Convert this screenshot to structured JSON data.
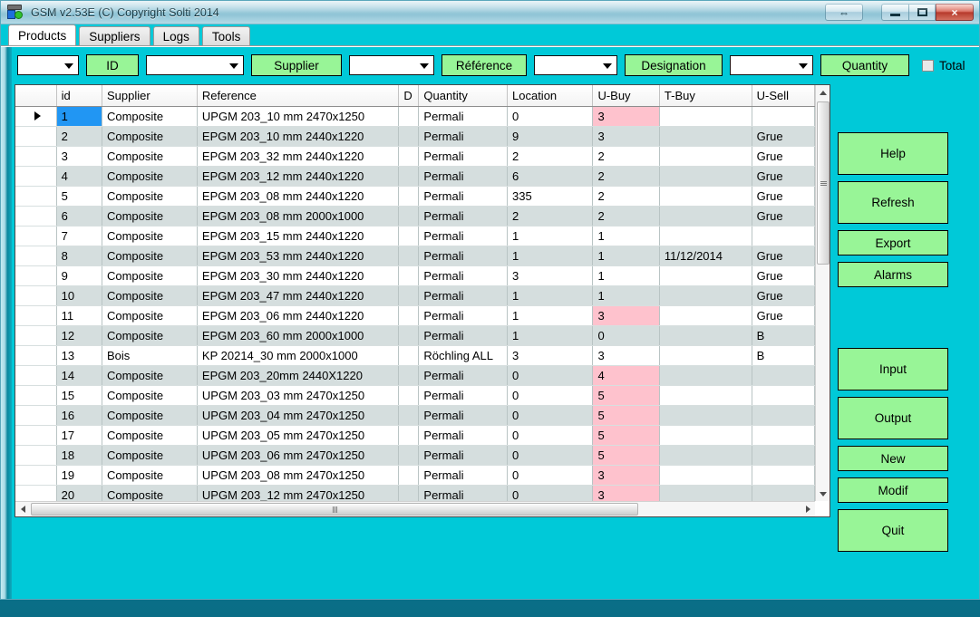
{
  "window": {
    "title": "GSM v2.53E (C) Copyright Solti 2014",
    "icon": "app-book-icon",
    "buttons": {
      "resize": "⇔",
      "minimize": "minimize-icon",
      "maximize": "maximize-icon",
      "close": "×"
    }
  },
  "tabs": [
    {
      "label": "Products",
      "active": true
    },
    {
      "label": "Suppliers",
      "active": false
    },
    {
      "label": "Logs",
      "active": false
    },
    {
      "label": "Tools",
      "active": false
    }
  ],
  "filterbar": {
    "combos": [
      {
        "id": "cb-id",
        "value": ""
      },
      {
        "id": "cb-supplier",
        "value": ""
      },
      {
        "id": "cb-reference",
        "value": ""
      },
      {
        "id": "cb-designation",
        "value": ""
      },
      {
        "id": "cb-quantity",
        "value": ""
      }
    ],
    "buttons": [
      {
        "id": "btn-id",
        "label": "ID"
      },
      {
        "id": "btn-supplier",
        "label": "Supplier"
      },
      {
        "id": "btn-reference",
        "label": "Référence"
      },
      {
        "id": "btn-designation",
        "label": "Designation"
      },
      {
        "id": "btn-quantity",
        "label": "Quantity"
      }
    ],
    "total": {
      "label": "Total",
      "checked": false
    }
  },
  "grid": {
    "columns": [
      {
        "key": "marker",
        "label": ""
      },
      {
        "key": "id",
        "label": "id"
      },
      {
        "key": "sup",
        "label": "Supplier"
      },
      {
        "key": "ref",
        "label": "Reference"
      },
      {
        "key": "desig",
        "label": "D"
      },
      {
        "key": "loc",
        "label": "Quantity"
      },
      {
        "key": "qty",
        "label": "Location"
      },
      {
        "key": "ubuy",
        "label": "U-Buy"
      },
      {
        "key": "tbuy",
        "label": "T-Buy"
      },
      {
        "key": "usell",
        "label": "U-Sell"
      }
    ],
    "rows": [
      {
        "marker": true,
        "id": "1",
        "sup": "Composite",
        "ref": "UPGM 203_10 mm 2470x1250",
        "desig": "",
        "loc": "Permali",
        "qty": "0",
        "ubuy": "3",
        "ubuy_warn": true,
        "tbuy": "",
        "usell": "",
        "selected": true
      },
      {
        "marker": false,
        "id": "2",
        "sup": "Composite",
        "ref": "EPGM 203_10 mm 2440x1220",
        "desig": "",
        "loc": "Permali",
        "qty": "9",
        "ubuy": "3",
        "ubuy_warn": false,
        "tbuy": "",
        "usell": "Grue"
      },
      {
        "marker": false,
        "id": "3",
        "sup": "Composite",
        "ref": "EPGM 203_32 mm 2440x1220",
        "desig": "",
        "loc": "Permali",
        "qty": "2",
        "ubuy": "2",
        "ubuy_warn": false,
        "tbuy": "",
        "usell": "Grue"
      },
      {
        "marker": false,
        "id": "4",
        "sup": "Composite",
        "ref": "EPGM 203_12 mm 2440x1220",
        "desig": "",
        "loc": "Permali",
        "qty": "6",
        "ubuy": "2",
        "ubuy_warn": false,
        "tbuy": "",
        "usell": "Grue"
      },
      {
        "marker": false,
        "id": "5",
        "sup": "Composite",
        "ref": "EPGM 203_08 mm 2440x1220",
        "desig": "",
        "loc": "Permali",
        "qty": "335",
        "ubuy": "2",
        "ubuy_warn": false,
        "tbuy": "",
        "usell": "Grue"
      },
      {
        "marker": false,
        "id": "6",
        "sup": "Composite",
        "ref": "EPGM 203_08 mm 2000x1000",
        "desig": "",
        "loc": "Permali",
        "qty": "2",
        "ubuy": "2",
        "ubuy_warn": false,
        "tbuy": "",
        "usell": "Grue"
      },
      {
        "marker": false,
        "id": "7",
        "sup": "Composite",
        "ref": "EPGM 203_15 mm 2440x1220",
        "desig": "",
        "loc": "Permali",
        "qty": "1",
        "ubuy": "1",
        "ubuy_warn": false,
        "tbuy": "",
        "usell": ""
      },
      {
        "marker": false,
        "id": "8",
        "sup": "Composite",
        "ref": "EPGM 203_53 mm 2440x1220",
        "desig": "",
        "loc": "Permali",
        "qty": "1",
        "ubuy": "1",
        "ubuy_warn": false,
        "tbuy": "11/12/2014",
        "usell": "Grue"
      },
      {
        "marker": false,
        "id": "9",
        "sup": "Composite",
        "ref": "EPGM 203_30 mm 2440x1220",
        "desig": "",
        "loc": "Permali",
        "qty": "3",
        "ubuy": "1",
        "ubuy_warn": false,
        "tbuy": "",
        "usell": "Grue"
      },
      {
        "marker": false,
        "id": "10",
        "sup": "Composite",
        "ref": "EPGM 203_47 mm 2440x1220",
        "desig": "",
        "loc": "Permali",
        "qty": "1",
        "ubuy": "1",
        "ubuy_warn": false,
        "tbuy": "",
        "usell": "Grue"
      },
      {
        "marker": false,
        "id": "11",
        "sup": "Composite",
        "ref": "EPGM 203_06 mm 2440x1220",
        "desig": "",
        "loc": "Permali",
        "qty": "1",
        "ubuy": "3",
        "ubuy_warn": true,
        "tbuy": "",
        "usell": "Grue"
      },
      {
        "marker": false,
        "id": "12",
        "sup": "Composite",
        "ref": "EPGM 203_60 mm 2000x1000",
        "desig": "",
        "loc": "Permali",
        "qty": "1",
        "ubuy": "0",
        "ubuy_warn": false,
        "tbuy": "",
        "usell": "B"
      },
      {
        "marker": false,
        "id": "13",
        "sup": "Bois",
        "ref": "KP 20214_30 mm 2000x1000",
        "desig": "",
        "loc": "Röchling ALL",
        "qty": "3",
        "ubuy": "3",
        "ubuy_warn": false,
        "tbuy": "",
        "usell": "B"
      },
      {
        "marker": false,
        "id": "14",
        "sup": "Composite",
        "ref": "EPGM 203_20mm 2440X1220",
        "desig": "",
        "loc": "Permali",
        "qty": "0",
        "ubuy": "4",
        "ubuy_warn": true,
        "tbuy": "",
        "usell": ""
      },
      {
        "marker": false,
        "id": "15",
        "sup": "Composite",
        "ref": "UPGM 203_03 mm 2470x1250",
        "desig": "",
        "loc": "Permali",
        "qty": "0",
        "ubuy": "5",
        "ubuy_warn": true,
        "tbuy": "",
        "usell": ""
      },
      {
        "marker": false,
        "id": "16",
        "sup": "Composite",
        "ref": "UPGM 203_04 mm 2470x1250",
        "desig": "",
        "loc": "Permali",
        "qty": "0",
        "ubuy": "5",
        "ubuy_warn": true,
        "tbuy": "",
        "usell": ""
      },
      {
        "marker": false,
        "id": "17",
        "sup": "Composite",
        "ref": "UPGM 203_05 mm 2470x1250",
        "desig": "",
        "loc": "Permali",
        "qty": "0",
        "ubuy": "5",
        "ubuy_warn": true,
        "tbuy": "",
        "usell": ""
      },
      {
        "marker": false,
        "id": "18",
        "sup": "Composite",
        "ref": "UPGM 203_06 mm 2470x1250",
        "desig": "",
        "loc": "Permali",
        "qty": "0",
        "ubuy": "5",
        "ubuy_warn": true,
        "tbuy": "",
        "usell": ""
      },
      {
        "marker": false,
        "id": "19",
        "sup": "Composite",
        "ref": "UPGM 203_08 mm 2470x1250",
        "desig": "",
        "loc": "Permali",
        "qty": "0",
        "ubuy": "3",
        "ubuy_warn": true,
        "tbuy": "",
        "usell": ""
      },
      {
        "marker": false,
        "id": "20",
        "sup": "Composite",
        "ref": "UPGM 203_12 mm 2470x1250",
        "desig": "",
        "loc": "Permali",
        "qty": "0",
        "ubuy": "3",
        "ubuy_warn": true,
        "tbuy": "",
        "usell": ""
      }
    ]
  },
  "actions": [
    {
      "label": "Help",
      "size": "tall"
    },
    {
      "label": "Refresh",
      "size": "tall"
    },
    {
      "label": "Export",
      "size": "short"
    },
    {
      "label": "Alarms",
      "size": "short"
    },
    {
      "label": "Input",
      "size": "tall"
    },
    {
      "label": "Output",
      "size": "tall"
    },
    {
      "label": "New",
      "size": "short"
    },
    {
      "label": "Modif",
      "size": "short"
    },
    {
      "label": "Quit",
      "size": "tall"
    }
  ],
  "colors": {
    "teal_background": "#00c9d8",
    "button_green": "#98f597",
    "row_alt": "#d5dede",
    "warn_pink": "#fec2cd",
    "selection_blue": "#2196f3"
  }
}
